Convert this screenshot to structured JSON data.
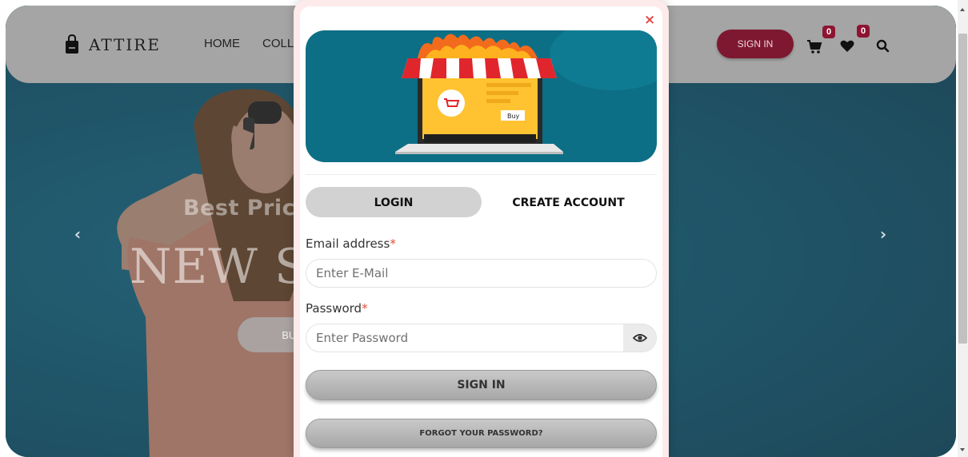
{
  "header": {
    "logo_text": "ATTIRE",
    "nav": [
      "HOME",
      "COLL"
    ],
    "signin_label": "SIGN IN",
    "cart_count": "0",
    "wishlist_count": "0",
    "icons": [
      "bag-icon",
      "cart-icon",
      "heart-icon",
      "search-icon"
    ]
  },
  "hero": {
    "kicker": "Best Price",
    "title": "NEW SE",
    "button_label": "BUY N",
    "prev_arrow": "‹",
    "next_arrow": "›"
  },
  "modal": {
    "close_glyph": "×",
    "banner_tag": "Buy",
    "tabs": {
      "login": "LOGIN",
      "create": "CREATE ACCOUNT"
    },
    "email_label": "Email address",
    "email_placeholder": "Enter E-Mail",
    "password_label": "Password",
    "password_placeholder": "Enter Password",
    "required_mark": "*",
    "signin_button": "SIGN IN",
    "forgot_button": "FORGOT YOUR PASSWORD?"
  },
  "colors": {
    "accent": "#7d1830",
    "hero_bg": "#0b6f93",
    "banner_bg": "#0d6f85",
    "required": "#e24e39",
    "close": "#e34a4a"
  }
}
